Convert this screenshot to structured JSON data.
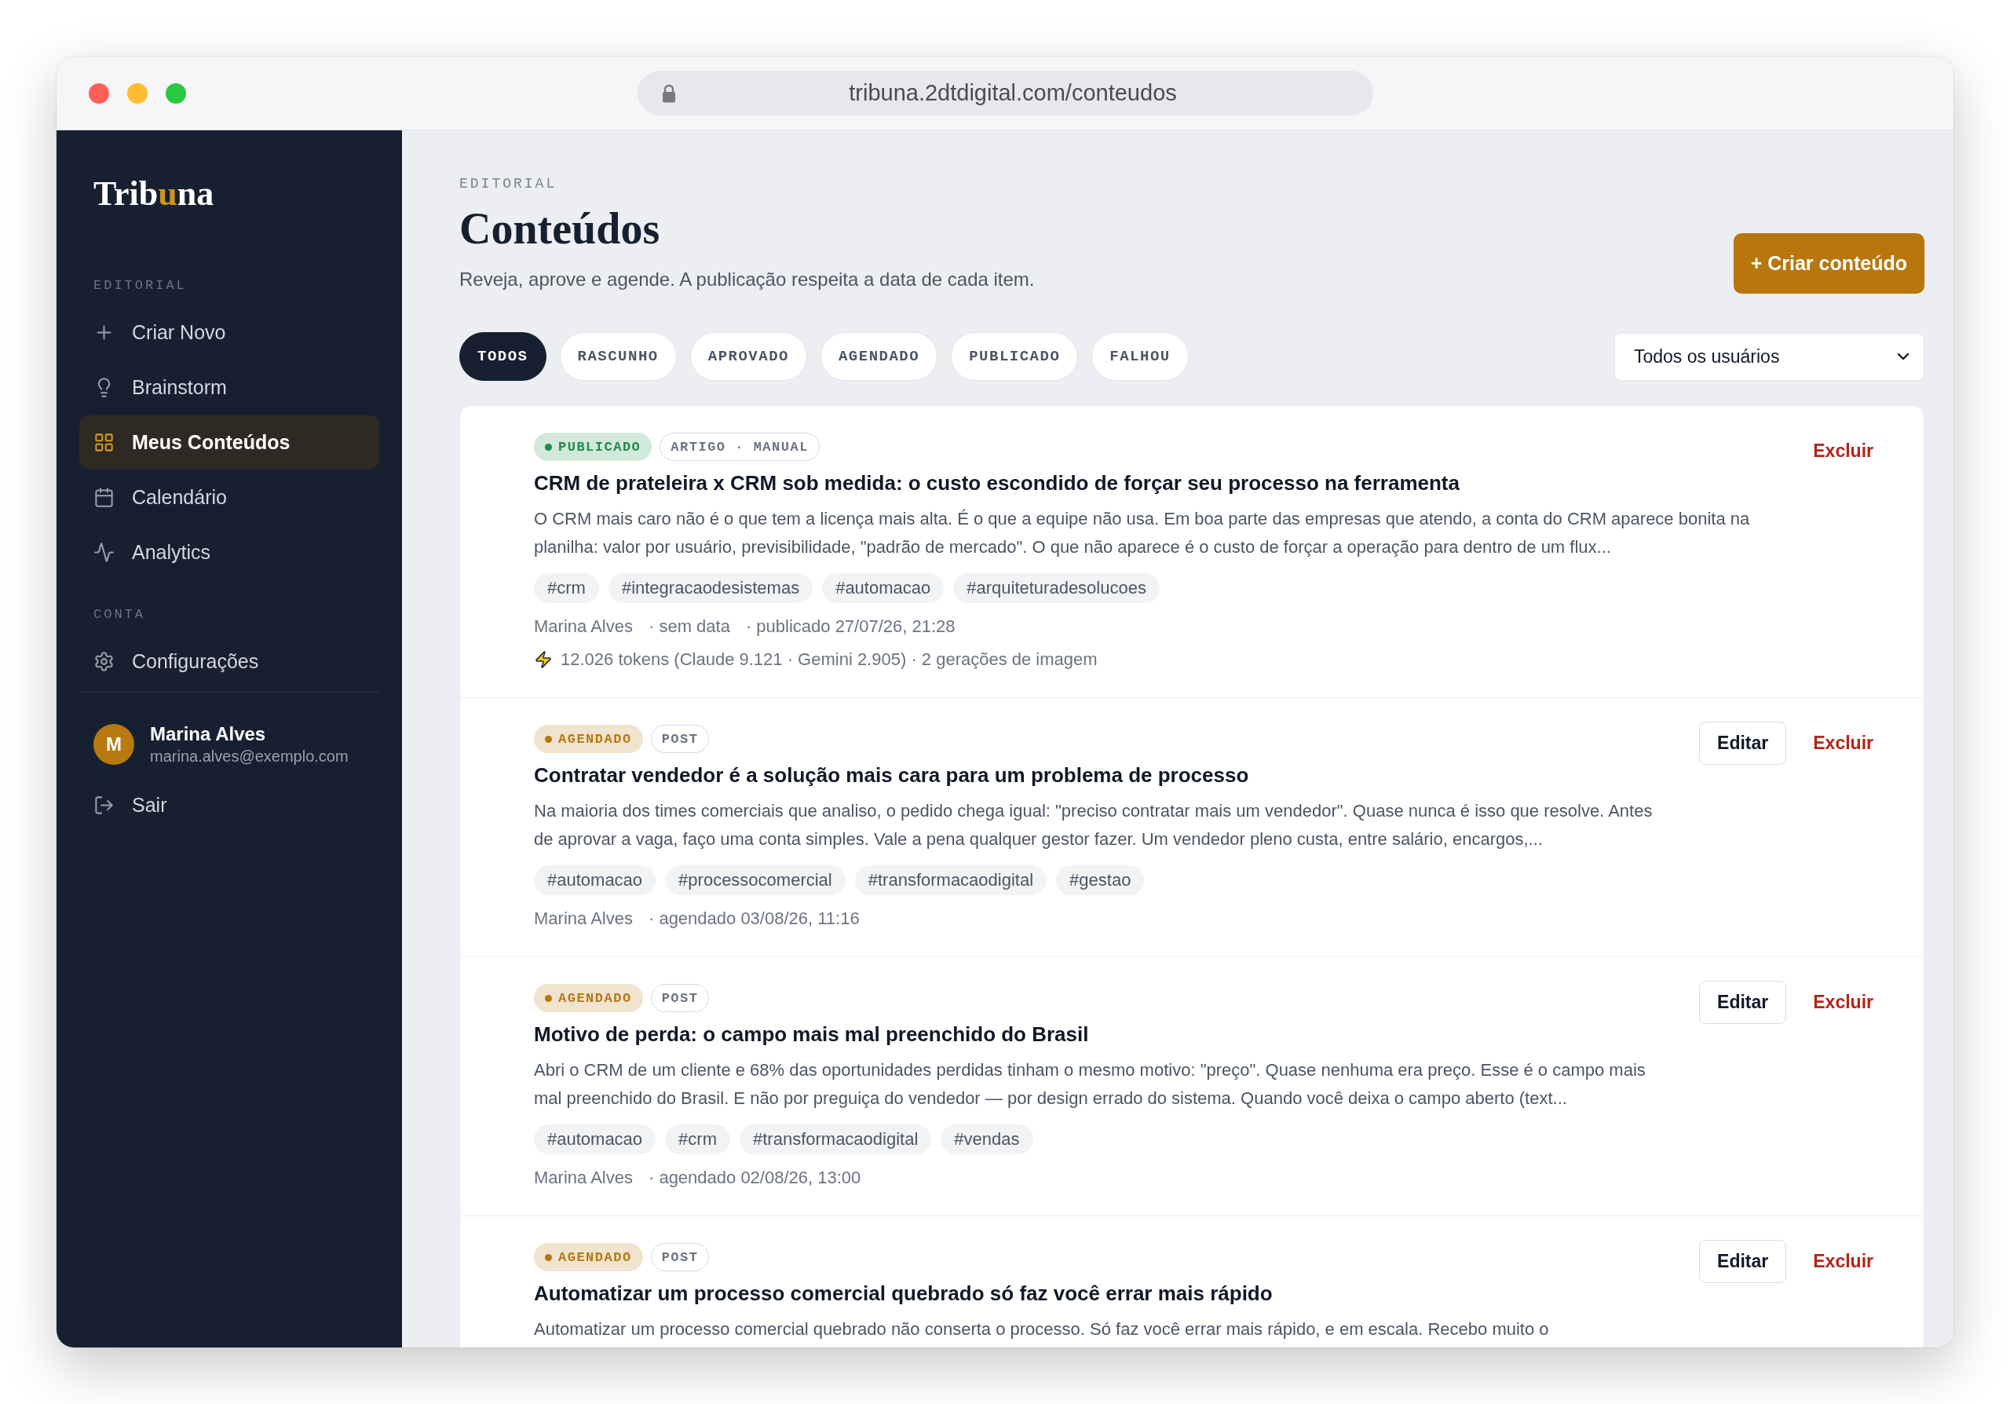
{
  "browser": {
    "url": "tribuna.2dtdigital.com/conteudos"
  },
  "sidebar": {
    "logo": {
      "lead": "Trib",
      "accent": "u",
      "tail": "na"
    },
    "sections": [
      {
        "label": "EDITORIAL",
        "items": [
          {
            "label": "Criar Novo",
            "selected": false
          },
          {
            "label": "Brainstorm",
            "selected": false
          },
          {
            "label": "Meus Conteúdos",
            "selected": true
          },
          {
            "label": "Calendário",
            "selected": false
          },
          {
            "label": "Analytics",
            "selected": false
          }
        ]
      },
      {
        "label": "CONTA",
        "items": [
          {
            "label": "Configurações",
            "selected": false
          }
        ]
      }
    ],
    "user": {
      "initial": "M",
      "name": "Marina Alves",
      "email": "marina.alves@exemplo.com"
    },
    "logout": "Sair"
  },
  "header": {
    "eyebrow": "EDITORIAL",
    "title": "Conteúdos",
    "subtitle": "Reveja, aprove e agende. A publicação respeita a data de cada item.",
    "create_button": "+ Criar conteúdo"
  },
  "filters": [
    {
      "label": "TODOS",
      "selected": true
    },
    {
      "label": "RASCUNHO",
      "selected": false
    },
    {
      "label": "APROVADO",
      "selected": false
    },
    {
      "label": "AGENDADO",
      "selected": false
    },
    {
      "label": "PUBLICADO",
      "selected": false
    },
    {
      "label": "FALHOU",
      "selected": false
    }
  ],
  "user_filter": {
    "value": "Todos os usuários"
  },
  "items": [
    {
      "status": {
        "label": "PUBLICADO",
        "color": "#1f8a4c"
      },
      "type": "ARTIGO · MANUAL",
      "title": "CRM de prateleira x CRM sob medida: o custo escondido de forçar seu processo na ferramenta",
      "excerpt": "O CRM mais caro não é o que tem a licença mais alta. É o que a equipe não usa. Em boa parte das empresas que atendo, a conta do CRM aparece bonita na planilha: valor por usuário, previsibilidade, \"padrão de mercado\". O que não aparece é o custo de forçar a operação para dentro de um flux...",
      "tags": [
        "#crm",
        "#integracaodesistemas",
        "#automacao",
        "#arquiteturadesolucoes"
      ],
      "author": "Marina Alves",
      "dates": [
        "· sem data",
        "· publicado 27/07/26, 21:28"
      ],
      "usage": "12.026 tokens (Claude 9.121 · Gemini 2.905) · 2 gerações de imagem",
      "actions": [
        {
          "kind": "delete",
          "label": "Excluir"
        }
      ]
    },
    {
      "status": {
        "label": "AGENDADO",
        "color": "#b7770e"
      },
      "type": "POST",
      "title": "Contratar vendedor é a solução mais cara para um problema de processo",
      "excerpt": "Na maioria dos times comerciais que analiso, o pedido chega igual: \"preciso contratar mais um vendedor\". Quase nunca é isso que resolve. Antes de aprovar a vaga, faço uma conta simples. Vale a pena qualquer gestor fazer. Um vendedor pleno custa, entre salário, encargos,...",
      "tags": [
        "#automacao",
        "#processocomercial",
        "#transformacaodigital",
        "#gestao"
      ],
      "author": "Marina Alves",
      "dates": [
        "· agendado 03/08/26, 11:16"
      ],
      "actions": [
        {
          "kind": "edit",
          "label": "Editar"
        },
        {
          "kind": "delete",
          "label": "Excluir"
        }
      ]
    },
    {
      "status": {
        "label": "AGENDADO",
        "color": "#b7770e"
      },
      "type": "POST",
      "title": "Motivo de perda: o campo mais mal preenchido do Brasil",
      "excerpt": "Abri o CRM de um cliente e 68% das oportunidades perdidas tinham o mesmo motivo: \"preço\". Quase nenhuma era preço. Esse é o campo mais mal preenchido do Brasil. E não por preguiça do vendedor — por design errado do sistema. Quando você deixa o campo aberto (text...",
      "tags": [
        "#automacao",
        "#crm",
        "#transformacaodigital",
        "#vendas"
      ],
      "author": "Marina Alves",
      "dates": [
        "· agendado 02/08/26, 13:00"
      ],
      "actions": [
        {
          "kind": "edit",
          "label": "Editar"
        },
        {
          "kind": "delete",
          "label": "Excluir"
        }
      ]
    },
    {
      "status": {
        "label": "AGENDADO",
        "color": "#b7770e"
      },
      "type": "POST",
      "title": "Automatizar um processo comercial quebrado só faz você errar mais rápido",
      "excerpt": "Automatizar um processo comercial quebrado não conserta o processo. Só faz você errar mais rápido, e em escala. Recebo muito o",
      "actions": [
        {
          "kind": "edit",
          "label": "Editar"
        },
        {
          "kind": "delete",
          "label": "Excluir"
        }
      ]
    }
  ]
}
